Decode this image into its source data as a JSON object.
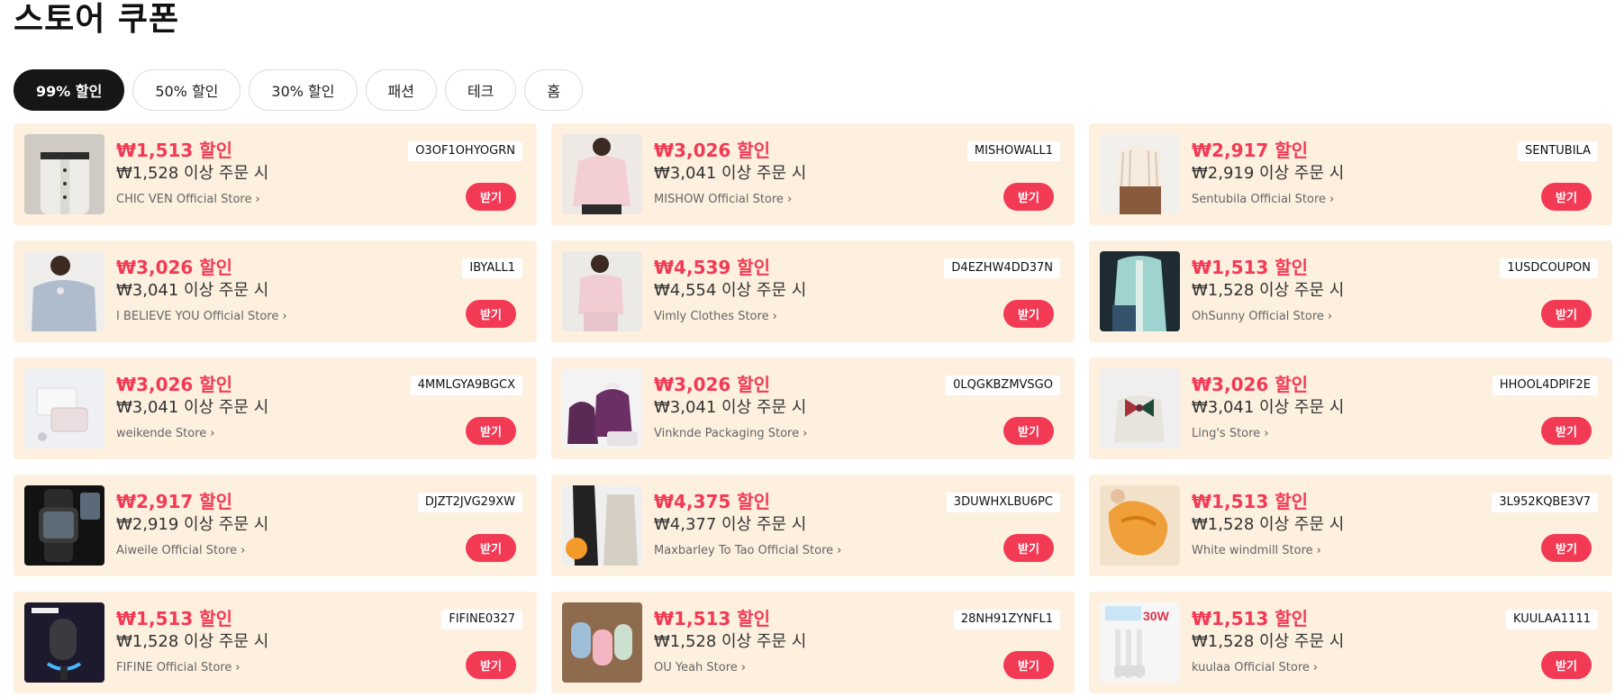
{
  "page": {
    "title": "스토어 쿠폰"
  },
  "tabs": [
    {
      "label": "99% 할인",
      "active": true
    },
    {
      "label": "50% 할인",
      "active": false
    },
    {
      "label": "30% 할인",
      "active": false
    },
    {
      "label": "패션",
      "active": false
    },
    {
      "label": "테크",
      "active": false
    },
    {
      "label": "홈",
      "active": false
    }
  ],
  "coupon_button_label": "받기",
  "store_chevron": "›",
  "colors": {
    "accent": "#f23a55",
    "card_background": "#fef0df",
    "active_tab": "#161616"
  },
  "coupons": [
    {
      "amount": "₩1,513 할인",
      "min_order": "₩1,528 이상 주문 시",
      "store": "CHIC VEN Official Store",
      "code": "O3OF1OHYOGRN",
      "image": "cardigan-photo"
    },
    {
      "amount": "₩3,026 할인",
      "min_order": "₩3,041 이상 주문 시",
      "store": "MISHOW Official Store",
      "code": "MISHOWALL1",
      "image": "pink-blouse-photo"
    },
    {
      "amount": "₩2,917 할인",
      "min_order": "₩2,919 이상 주문 시",
      "store": "Sentubila Official Store",
      "code": "SENTUBILA",
      "image": "striped-shirt-photo"
    },
    {
      "amount": "₩3,026 할인",
      "min_order": "₩3,041 이상 주문 시",
      "store": "I BELIEVE YOU Official Store",
      "code": "IBYALL1",
      "image": "blue-sweater-photo"
    },
    {
      "amount": "₩4,539 할인",
      "min_order": "₩4,554 이상 주문 시",
      "store": "Vimly Clothes Store",
      "code": "D4EZHW4DD37N",
      "image": "pink-knit-photo"
    },
    {
      "amount": "₩1,513 할인",
      "min_order": "₩1,528 이상 주문 시",
      "store": "OhSunny Official Store",
      "code": "1USDCOUPON",
      "image": "mint-jacket-photo"
    },
    {
      "amount": "₩3,026 할인",
      "min_order": "₩3,041 이상 주문 시",
      "store": "weikende Store",
      "code": "4MMLGYA9BGCX",
      "image": "jewelry-pouch-photo"
    },
    {
      "amount": "₩3,026 할인",
      "min_order": "₩3,041 이상 주문 시",
      "store": "Vinknde Packaging Store",
      "code": "0LQGKBZMVSGO",
      "image": "purple-bags-photo"
    },
    {
      "amount": "₩3,026 할인",
      "min_order": "₩3,041 이상 주문 시",
      "store": "Ling's Store",
      "code": "HHOOL4DPIF2E",
      "image": "ribbon-bag-photo"
    },
    {
      "amount": "₩2,917 할인",
      "min_order": "₩2,919 이상 주문 시",
      "store": "Aiweile Official Store",
      "code": "DJZT2JVG29XW",
      "image": "smartwatch-photo"
    },
    {
      "amount": "₩4,375 할인",
      "min_order": "₩4,377 이상 주문 시",
      "store": "Maxbarley To Tao Official Store",
      "code": "3DUWHXLBU6PC",
      "image": "leggings-photo"
    },
    {
      "amount": "₩1,513 할인",
      "min_order": "₩1,528 이상 주문 시",
      "store": "White windmill Store",
      "code": "3L952KQBE3V7",
      "image": "orange-hair-clip-photo"
    },
    {
      "amount": "₩1,513 할인",
      "min_order": "₩1,528 이상 주문 시",
      "store": "FIFINE Official Store",
      "code": "FIFINE0327",
      "image": "microphone-photo"
    },
    {
      "amount": "₩1,513 할인",
      "min_order": "₩1,528 이상 주문 시",
      "store": "OU Yeah Store",
      "code": "28NH91ZYNFL1",
      "image": "hair-clips-photo"
    },
    {
      "amount": "₩1,513 할인",
      "min_order": "₩1,528 이상 주문 시",
      "store": "kuulaa Official Store",
      "code": "KUULAA1111",
      "image": "usb-cable-photo"
    }
  ]
}
